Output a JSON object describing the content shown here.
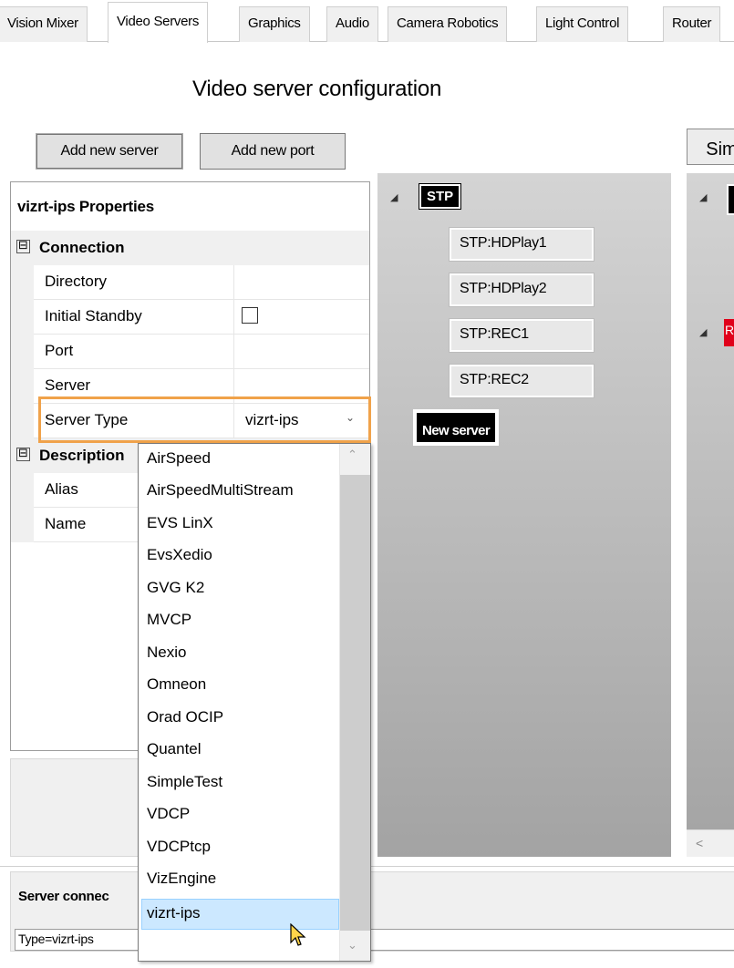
{
  "tabs": [
    {
      "label": "Vision Mixer"
    },
    {
      "label": "Video Servers"
    },
    {
      "label": "Graphics"
    },
    {
      "label": "Audio"
    },
    {
      "label": "Camera Robotics"
    },
    {
      "label": "Light Control"
    },
    {
      "label": "Router"
    }
  ],
  "active_tab": "Video Servers",
  "page_title": "Video server configuration",
  "toolbar": {
    "add_server_label": "Add new server",
    "add_port_label": "Add new port",
    "right_button_label": "Sim"
  },
  "properties": {
    "title": "vizrt-ips Properties",
    "collapse_glyph": "⊟",
    "categories": [
      {
        "label": "Connection",
        "rows": [
          {
            "name": "Directory",
            "value": ""
          },
          {
            "name": "Initial Standby",
            "value": ""
          },
          {
            "name": "Port",
            "value": ""
          },
          {
            "name": "Server",
            "value": ""
          },
          {
            "name": "Server Type",
            "value": "vizrt-ips"
          }
        ]
      },
      {
        "label": "Description",
        "rows": [
          {
            "name": "Alias",
            "value": ""
          },
          {
            "name": "Name",
            "value": ""
          }
        ]
      }
    ],
    "initial_standby_checked": false
  },
  "server_type_dropdown": {
    "selected": "vizrt-ips",
    "options": [
      "AirSpeed",
      "AirSpeedMultiStream",
      "EVS LinX",
      "EvsXedio",
      "GVG K2",
      "MVCP",
      "Nexio",
      "Omneon",
      "Orad OCIP",
      "Quantel",
      "SimpleTest",
      "VDCP",
      "VDCPtcp",
      "VizEngine",
      "vizrt-ips"
    ]
  },
  "tree": {
    "server": "STP",
    "ports": [
      "STP:HDPlay1",
      "STP:HDPlay2",
      "STP:REC1",
      "STP:REC2"
    ],
    "new_server_label": "New server",
    "expand_glyph": "◢"
  },
  "right_panel": {
    "red_node_label": "R"
  },
  "connection": {
    "title": "Server connec",
    "value": "Type=vizrt-ips"
  },
  "colors": {
    "highlight_border": "#f0a24a",
    "selected_item_bg": "#cce8ff",
    "panel_gray": "#a3a3a3",
    "red_node": "#e0001a"
  }
}
